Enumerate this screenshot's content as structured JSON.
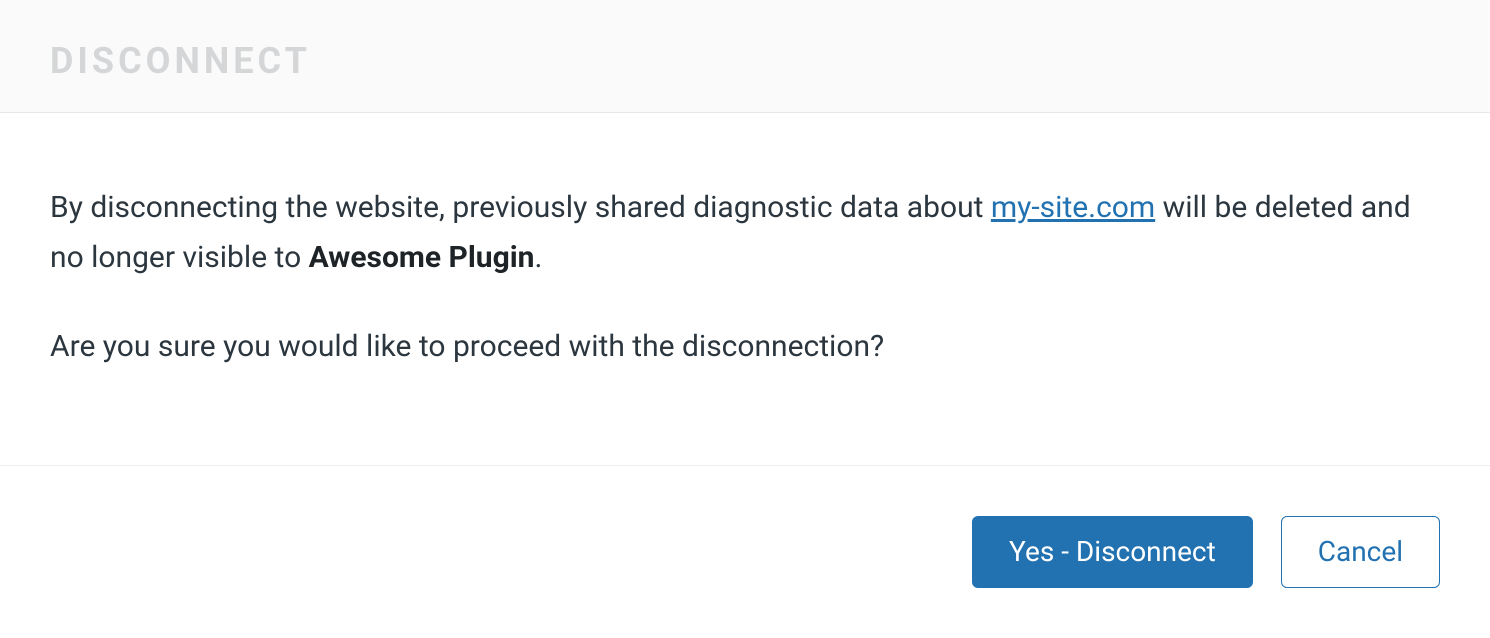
{
  "dialog": {
    "title": "Disconnect",
    "body": {
      "para1_prefix": "By disconnecting the website, previously shared diagnostic data about ",
      "site_link": "my-site.com",
      "para1_mid": " will be deleted and no longer visible to ",
      "plugin_name": "Awesome Plugin",
      "para1_suffix": ".",
      "para2": "Are you sure you would like to proceed with the disconnection?"
    },
    "actions": {
      "confirm": "Yes - Disconnect",
      "cancel": "Cancel"
    }
  }
}
